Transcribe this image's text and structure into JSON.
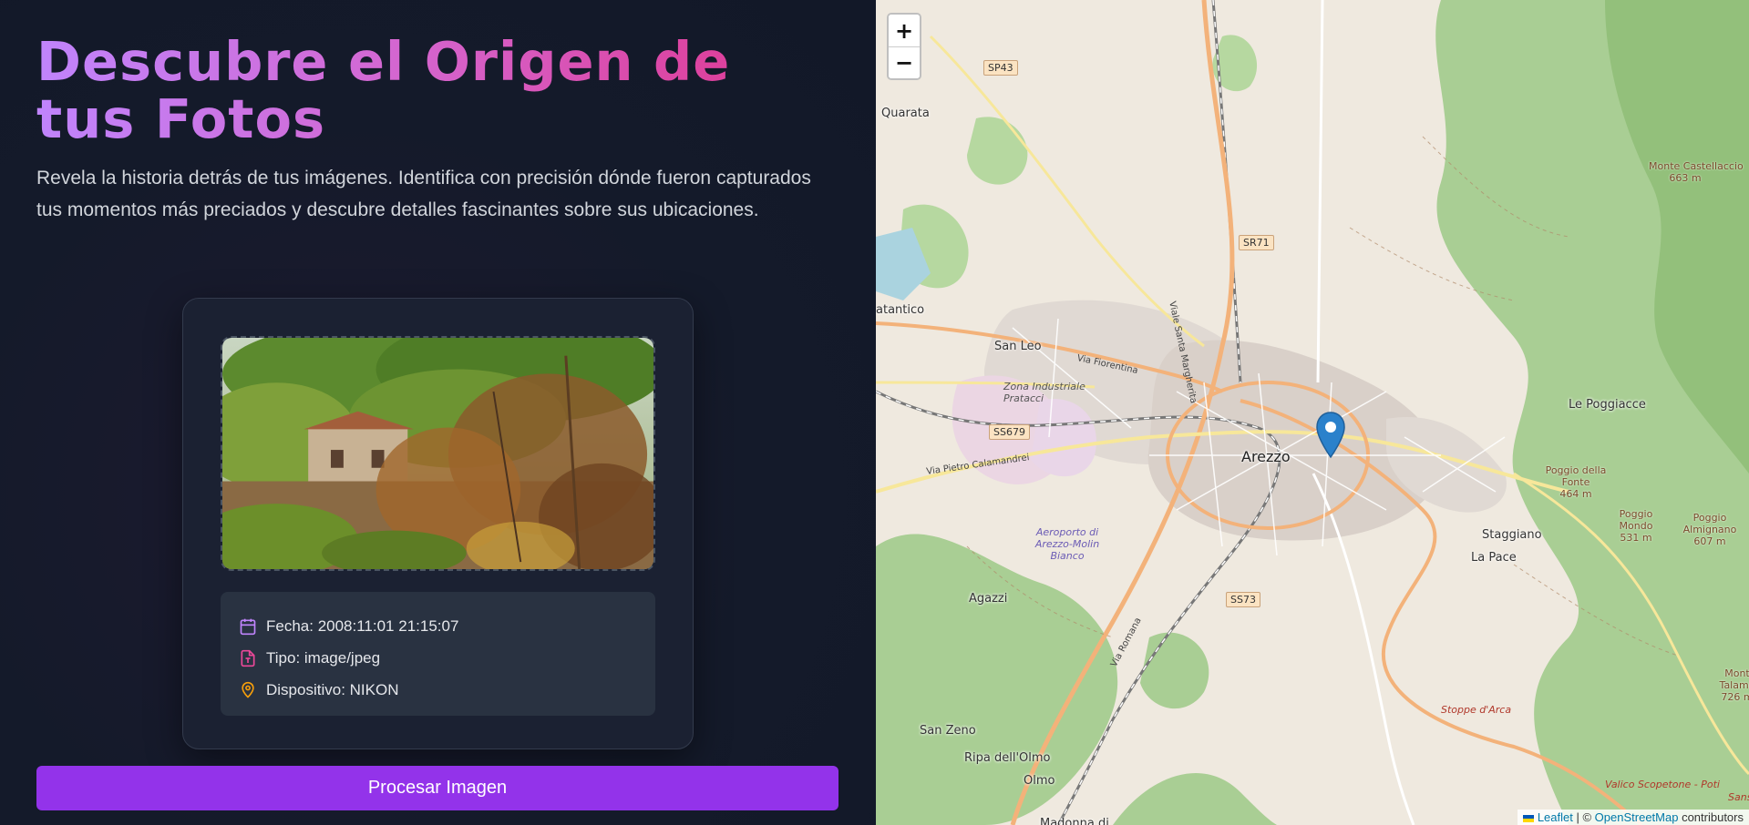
{
  "hero": {
    "title": "Descubre el Origen de tus Fotos",
    "subtitle": "Revela la historia detrás de tus imágenes. Identifica con precisión dónde fueron capturados tus momentos más preciados y descubre detalles fascinantes sobre sus ubicaciones."
  },
  "preview": {
    "meta": [
      {
        "icon": "calendar-icon",
        "text": "Fecha: 2008:11:01 21:15:07"
      },
      {
        "icon": "file-type-icon",
        "text": "Tipo: image/jpeg"
      },
      {
        "icon": "map-pin-icon",
        "text": "Dispositivo: NIKON"
      }
    ]
  },
  "actions": {
    "process_label": "Procesar Imagen"
  },
  "colors": {
    "accent": "#9333ea",
    "title_gradient_start": "#c084fc",
    "title_gradient_end": "#e0338a",
    "marker": "#2a81cb"
  },
  "map": {
    "zoom_in": "+",
    "zoom_out": "−",
    "city": "Arezzo",
    "towns": [
      "Quarata",
      "San Leo",
      "atantico",
      "Le Poggiacce",
      "Staggiano",
      "La Pace",
      "Agazzi",
      "San Zeno",
      "Ripa dell'Olmo",
      "Olmo",
      "Madonna di"
    ],
    "roads": [
      "SP43",
      "SR71",
      "SS679",
      "SS73",
      "Via Fiorentina",
      "Via Pietro Calamandrei",
      "Viale Santa Margherita",
      "Via Romana"
    ],
    "industrial": "Zona Industriale Pratacci",
    "airport": "Aeroporto di Arezzo-Molin Bianco",
    "peaks": [
      {
        "name": "Monte Castellaccio",
        "elev": "663 m"
      },
      {
        "name": "Poggio della Fonte",
        "elev": "464 m"
      },
      {
        "name": "Poggio Mondo",
        "elev": "531 m"
      },
      {
        "name": "Poggio Almignano",
        "elev": "607 m"
      },
      {
        "name": "Mont Talamo",
        "elev": "726 m"
      }
    ],
    "misc": [
      "Stoppe d'Arca",
      "Valico Scopetone - Poti",
      "Sans"
    ],
    "attribution": {
      "leaflet": "Leaflet",
      "sep": " | © ",
      "osm": "OpenStreetMap",
      "suffix": " contributors"
    }
  }
}
